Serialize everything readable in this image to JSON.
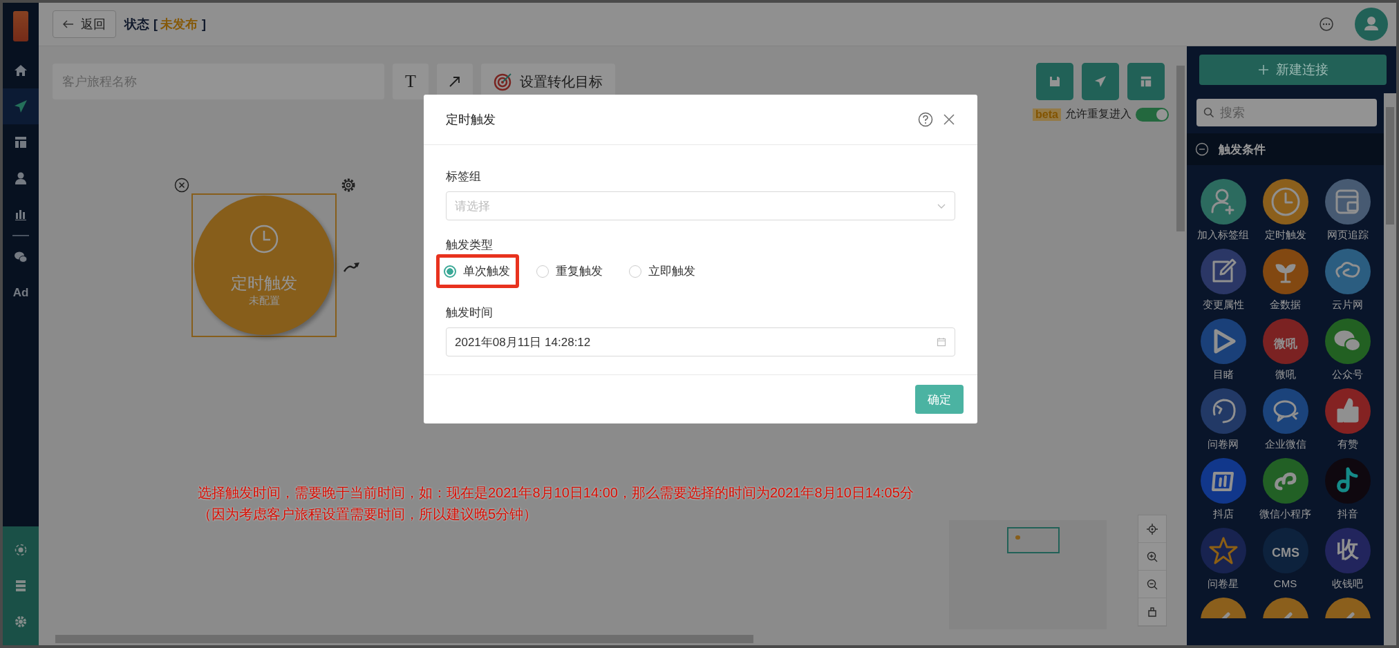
{
  "top_bar": {
    "back_button": "返回",
    "status_label": "状态",
    "bracket_open": "[",
    "status_value": "未发布",
    "bracket_close": "]"
  },
  "sidebar": {
    "items": [
      {
        "kind": "home",
        "selected": false
      },
      {
        "kind": "send",
        "selected": true
      },
      {
        "kind": "layout",
        "selected": false
      },
      {
        "kind": "user",
        "selected": false
      },
      {
        "kind": "chart",
        "selected": false
      },
      {
        "kind": "divider"
      },
      {
        "kind": "wechat",
        "selected": false
      },
      {
        "kind": "text",
        "label": "Ad",
        "selected": false
      }
    ],
    "bottom_items": [
      {
        "kind": "network"
      },
      {
        "kind": "server"
      },
      {
        "kind": "gear"
      }
    ]
  },
  "toolbar": {
    "name_placeholder": "客户旅程名称",
    "text_tool": "T",
    "goal_button": "设置转化目标"
  },
  "canvas": {
    "allow_reentry": {
      "badge": "beta",
      "label": "允许重复进入",
      "on": true
    },
    "node": {
      "title": "定时触发",
      "subtitle": "未配置",
      "selected": true
    }
  },
  "panel": {
    "new_button": "新建连接",
    "search_placeholder": "搜索",
    "section": {
      "title": "触发条件",
      "expanded": true
    },
    "items": [
      {
        "kind": "person-plus",
        "label": "加入标签组",
        "color": "#2c6b5f"
      },
      {
        "kind": "clock",
        "label": "定时触发",
        "color": "#8b5f1c"
      },
      {
        "kind": "browser",
        "label": "网页追踪",
        "color": "#475a72"
      },
      {
        "kind": "edit",
        "label": "变更属性",
        "color": "#2b3766"
      },
      {
        "kind": "plant",
        "label": "金数据",
        "color": "#824811"
      },
      {
        "kind": "cloud",
        "label": "云片网",
        "color": "#2b5d80"
      },
      {
        "kind": "play",
        "label": "目睹",
        "color": "#1a4079"
      },
      {
        "kind": "logo-text",
        "logo_text": "微吼",
        "label": "微吼",
        "color": "#7b2222"
      },
      {
        "kind": "wechat",
        "label": "公众号",
        "color": "#226022"
      },
      {
        "kind": "dog",
        "label": "问卷网",
        "color": "#223966"
      },
      {
        "kind": "chat",
        "label": "企业微信",
        "color": "#1b437b"
      },
      {
        "kind": "thumb",
        "label": "有赞",
        "color": "#842222"
      },
      {
        "kind": "store",
        "label": "抖店",
        "color": "#11378b"
      },
      {
        "kind": "link",
        "label": "微信小程序",
        "color": "#226025"
      },
      {
        "kind": "note",
        "label": "抖音",
        "color": "#0f080f"
      },
      {
        "kind": "star",
        "label": "问卷星",
        "color": "#182350"
      },
      {
        "kind": "logo-text",
        "logo_text": "CMS",
        "label": "CMS",
        "color": "#0d223d"
      },
      {
        "kind": "logo-text",
        "logo_text": "收",
        "label": "收钱吧",
        "color": "#22255d"
      },
      {
        "kind": "partial",
        "color": "#8b5f1c"
      },
      {
        "kind": "partial",
        "color": "#8b5f1c"
      },
      {
        "kind": "partial",
        "color": "#8b5f1c"
      }
    ]
  },
  "dialog": {
    "title": "定时触发",
    "fields": [
      {
        "kind": "select",
        "label": "标签组",
        "placeholder": "请选择"
      },
      {
        "kind": "radio",
        "label": "触发类型",
        "options": [
          {
            "label": "单次触发",
            "selected": true,
            "highlighted": true
          },
          {
            "label": "重复触发",
            "selected": false,
            "highlighted": false
          },
          {
            "label": "立即触发",
            "selected": false,
            "highlighted": false
          }
        ]
      },
      {
        "kind": "date",
        "label": "触发时间",
        "value": "2021年08月11日 14:28:12"
      }
    ],
    "confirm_button": "确定"
  },
  "annotation": [
    "选择触发时间，需要晚于当前时间，如：现在是2021年8月10日14:00，那么需要选择的时间为2021年8月10日14:05分",
    "（因为考虑客户旅程设置需要时间，所以建议晚5分钟）"
  ]
}
